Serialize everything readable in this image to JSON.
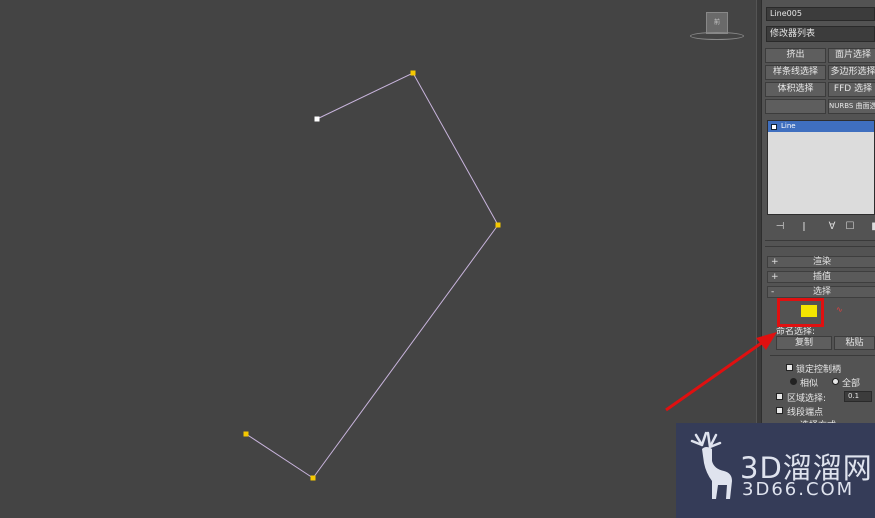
{
  "viewport": {
    "background": "#444444",
    "spline_color": "#c8b4dc",
    "vertex_color": "#f5c800",
    "first_vertex_color": "#ffffff",
    "viewcube_label": "前"
  },
  "panel": {
    "object_name": "Line005",
    "modifier_list": "修改器列表",
    "buttons": {
      "extrude": "挤出",
      "patch_select": "面片选择",
      "spline_select": "样条线选择",
      "poly_select": "多边形选择",
      "volume_select": "体积选择",
      "ffd_select": "FFD 选择",
      "nurbs_surface": "NURBS 曲面选择"
    },
    "stack": {
      "items": [
        "Line"
      ]
    },
    "rollouts": {
      "render": {
        "sign": "+",
        "label": "渲染"
      },
      "interpolation": {
        "sign": "+",
        "label": "插值"
      },
      "selection": {
        "sign": "-",
        "label": "选择"
      }
    },
    "selection": {
      "named_selection": "命名选择:",
      "copy": "复制",
      "paste": "粘贴",
      "lock_handles": "锁定控制柄",
      "similar": "相似",
      "all": "全部",
      "area_select": "区域选择:",
      "area_value": "0.1",
      "segment_end": "线段端点",
      "select_by": "选择方式..."
    },
    "highlight_color": "#e01010"
  },
  "watermark": {
    "title": "3D溜溜网",
    "url": "3D66.COM"
  }
}
